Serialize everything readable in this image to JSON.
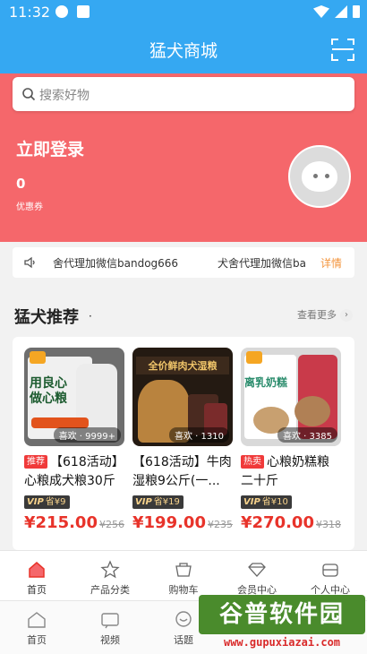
{
  "status_bar": {
    "time": "11:32"
  },
  "app": {
    "title": "猛犬商城"
  },
  "search": {
    "placeholder": "搜索好物"
  },
  "user": {
    "login_text": "立即登录",
    "coupon_count": "0",
    "coupon_label": "优惠券"
  },
  "notice": {
    "text1": "舍代理加微信bandog666",
    "text2": "犬舍代理加微信ba",
    "detail": "详情"
  },
  "recommend": {
    "title": "猛犬推荐",
    "dot": "·",
    "more": "查看更多",
    "more_icon": "chevron-right-icon"
  },
  "products": [
    {
      "image_caption": "用良心做心粮",
      "likes": "喜欢 · 9999+",
      "tag": "推荐",
      "name": "【618活动】心粮成犬粮30斤",
      "vip": "VIP",
      "vip_save": "省¥9",
      "price": "¥215.00",
      "old_price": "¥256"
    },
    {
      "image_caption": "全价鲜肉犬湿粮",
      "likes": "喜欢 · 1310",
      "tag": "",
      "name": "【618活动】牛肉湿粮9公斤(一...",
      "vip": "VIP",
      "vip_save": "省¥19",
      "price": "¥199.00",
      "old_price": "¥235"
    },
    {
      "image_caption": "离乳奶糕",
      "likes": "喜欢 · 3385",
      "tag": "热卖",
      "name": "心粮奶糕粮二十斤",
      "vip": "VIP",
      "vip_save": "省¥10",
      "price": "¥270.00",
      "old_price": "¥318"
    }
  ],
  "tabbar_top": [
    {
      "label": "首页",
      "icon": "home-icon"
    },
    {
      "label": "产品分类",
      "icon": "star-icon"
    },
    {
      "label": "购物车",
      "icon": "cart-icon"
    },
    {
      "label": "会员中心",
      "icon": "diamond-icon"
    },
    {
      "label": "个人中心",
      "icon": "person-icon"
    }
  ],
  "tabbar_bottom": [
    {
      "label": "首页",
      "icon": "home-icon"
    },
    {
      "label": "视频",
      "icon": "video-icon"
    },
    {
      "label": "话题",
      "icon": "chat-icon"
    }
  ],
  "watermark": {
    "title": "谷普软件园",
    "url": "www.gupuxiazai.com"
  },
  "colors": {
    "header": "#35a8f2",
    "hero": "#f5676b",
    "price": "#e8332a",
    "detail": "#f3943c"
  }
}
